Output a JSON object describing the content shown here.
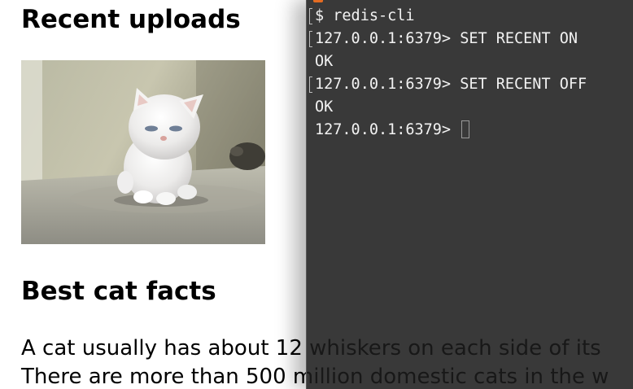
{
  "webpage": {
    "recent_heading": "Recent uploads",
    "cat_image": {
      "subject": "white fluffy kitten sitting on a floor",
      "icon": "cat-photo"
    },
    "facts_heading": "Best cat facts",
    "facts": [
      "A cat usually has about 12 whiskers on each side of its",
      "There are more than 500 million domestic cats in the w"
    ]
  },
  "terminal": {
    "accent_color": "#e46b21",
    "lines": [
      {
        "text": "$ redis-cli",
        "marked": true
      },
      {
        "text": "127.0.0.1:6379> SET RECENT ON",
        "marked": true
      },
      {
        "text": "OK",
        "marked": false
      },
      {
        "text": "127.0.0.1:6379> SET RECENT OFF",
        "marked": true
      },
      {
        "text": "OK",
        "marked": false
      },
      {
        "text": "127.0.0.1:6379> ",
        "marked": false,
        "cursor": true
      }
    ]
  }
}
